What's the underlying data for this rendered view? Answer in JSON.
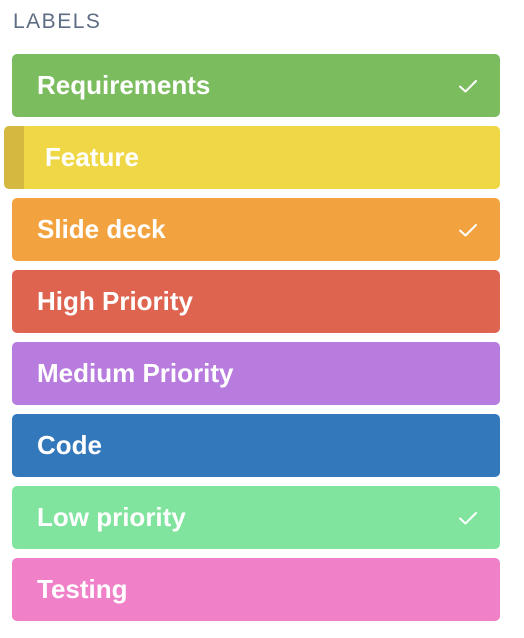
{
  "section": {
    "title": "LABELS"
  },
  "labels": [
    {
      "name": "Requirements",
      "color": "#7bbc5e",
      "checked": true
    },
    {
      "name": "Feature",
      "color": "#efd746",
      "hover_shade": "#d4b83f",
      "checked": false,
      "hovered": true
    },
    {
      "name": "Slide deck",
      "color": "#f2a340",
      "checked": true
    },
    {
      "name": "High Priority",
      "color": "#de6450",
      "checked": false
    },
    {
      "name": "Medium Priority",
      "color": "#b77cde",
      "checked": false
    },
    {
      "name": "Code",
      "color": "#3278bb",
      "checked": false
    },
    {
      "name": "Low priority",
      "color": "#80e49e",
      "checked": true
    },
    {
      "name": "Testing",
      "color": "#f081c8",
      "checked": false
    }
  ],
  "icons": {
    "check": "check-icon"
  }
}
